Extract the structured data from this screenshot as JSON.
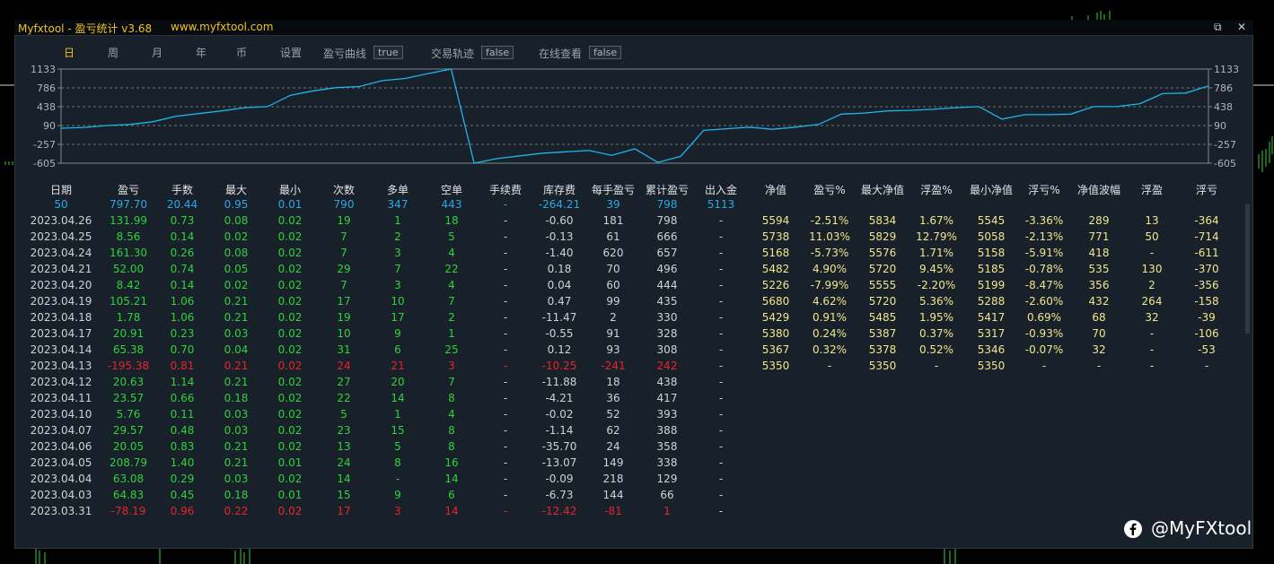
{
  "window": {
    "title": "Myfxtool - 盈亏统计 v3.68",
    "url": "www.myfxtool.com",
    "restore_glyph": "⧉",
    "close_glyph": "✕"
  },
  "tabs": [
    "日",
    "周",
    "月",
    "年",
    "币",
    "设置"
  ],
  "active_tab": "日",
  "toggles": [
    {
      "label": "盈亏曲线",
      "value": "true"
    },
    {
      "label": "交易轨迹",
      "value": "false"
    },
    {
      "label": "在线查看",
      "value": "false"
    }
  ],
  "chart_data": {
    "type": "line",
    "y_ticks": [
      "1133",
      "786",
      "438",
      "90",
      "-257",
      "-605"
    ],
    "ylim": [
      -605,
      1133
    ],
    "grid": "dashed horizontal",
    "line_color": "#1eb4ef",
    "values": [
      40,
      55,
      90,
      110,
      160,
      260,
      310,
      360,
      420,
      440,
      650,
      730,
      790,
      810,
      920,
      960,
      1050,
      1133,
      -605,
      -520,
      -470,
      -420,
      -395,
      -370,
      -460,
      -340,
      -590,
      -480,
      0,
      30,
      60,
      20,
      60,
      110,
      300,
      320,
      360,
      370,
      390,
      420,
      440,
      210,
      290,
      290,
      300,
      440,
      440,
      490,
      680,
      690,
      820
    ]
  },
  "table": {
    "left_headers": [
      "日期",
      "盈亏",
      "手数",
      "最大",
      "最小",
      "次数",
      "多单",
      "空单",
      "手续费",
      "库存费",
      "每手盈亏",
      "累计盈亏",
      "出入金"
    ],
    "right_headers": [
      "净值",
      "盈亏%",
      "最大净值",
      "浮盈%",
      "最小净值",
      "浮亏%",
      "净值波幅",
      "浮盈",
      "浮亏"
    ],
    "summary": [
      "50",
      "797.70",
      "20.44",
      "0.95",
      "0.01",
      "790",
      "347",
      "443",
      "-",
      "-264.21",
      "39",
      "798",
      "5113"
    ],
    "rows": [
      {
        "date": "2023.04.26",
        "pl": "131.99",
        "lots": "0.73",
        "max": "0.08",
        "min": "0.02",
        "count": "19",
        "long": "1",
        "short": "18",
        "fee": "-",
        "swap": "-0.60",
        "plpl": "181",
        "cum": "798",
        "io": "-",
        "loss": false
      },
      {
        "date": "2023.04.25",
        "pl": "8.56",
        "lots": "0.14",
        "max": "0.02",
        "min": "0.02",
        "count": "7",
        "long": "2",
        "short": "5",
        "fee": "-",
        "swap": "-0.13",
        "plpl": "61",
        "cum": "666",
        "io": "-",
        "loss": false
      },
      {
        "date": "2023.04.24",
        "pl": "161.30",
        "lots": "0.26",
        "max": "0.08",
        "min": "0.02",
        "count": "7",
        "long": "3",
        "short": "4",
        "fee": "-",
        "swap": "-1.40",
        "plpl": "620",
        "cum": "657",
        "io": "-",
        "loss": false
      },
      {
        "date": "2023.04.21",
        "pl": "52.00",
        "lots": "0.74",
        "max": "0.05",
        "min": "0.02",
        "count": "29",
        "long": "7",
        "short": "22",
        "fee": "-",
        "swap": "0.18",
        "plpl": "70",
        "cum": "496",
        "io": "-",
        "loss": false
      },
      {
        "date": "2023.04.20",
        "pl": "8.42",
        "lots": "0.14",
        "max": "0.02",
        "min": "0.02",
        "count": "7",
        "long": "3",
        "short": "4",
        "fee": "-",
        "swap": "0.04",
        "plpl": "60",
        "cum": "444",
        "io": "-",
        "loss": false
      },
      {
        "date": "2023.04.19",
        "pl": "105.21",
        "lots": "1.06",
        "max": "0.21",
        "min": "0.02",
        "count": "17",
        "long": "10",
        "short": "7",
        "fee": "-",
        "swap": "0.47",
        "plpl": "99",
        "cum": "435",
        "io": "-",
        "loss": false
      },
      {
        "date": "2023.04.18",
        "pl": "1.78",
        "lots": "1.06",
        "max": "0.21",
        "min": "0.02",
        "count": "19",
        "long": "17",
        "short": "2",
        "fee": "-",
        "swap": "-11.47",
        "plpl": "2",
        "cum": "330",
        "io": "-",
        "loss": false
      },
      {
        "date": "2023.04.17",
        "pl": "20.91",
        "lots": "0.23",
        "max": "0.03",
        "min": "0.02",
        "count": "10",
        "long": "9",
        "short": "1",
        "fee": "-",
        "swap": "-0.55",
        "plpl": "91",
        "cum": "328",
        "io": "-",
        "loss": false
      },
      {
        "date": "2023.04.14",
        "pl": "65.38",
        "lots": "0.70",
        "max": "0.04",
        "min": "0.02",
        "count": "31",
        "long": "6",
        "short": "25",
        "fee": "-",
        "swap": "0.12",
        "plpl": "93",
        "cum": "308",
        "io": "-",
        "loss": false
      },
      {
        "date": "2023.04.13",
        "pl": "-195.38",
        "lots": "0.81",
        "max": "0.21",
        "min": "0.02",
        "count": "24",
        "long": "21",
        "short": "3",
        "fee": "-",
        "swap": "-10.25",
        "plpl": "-241",
        "cum": "242",
        "io": "-",
        "loss": true
      },
      {
        "date": "2023.04.12",
        "pl": "20.63",
        "lots": "1.14",
        "max": "0.21",
        "min": "0.02",
        "count": "27",
        "long": "20",
        "short": "7",
        "fee": "-",
        "swap": "-11.88",
        "plpl": "18",
        "cum": "438",
        "io": "-",
        "loss": false
      },
      {
        "date": "2023.04.11",
        "pl": "23.57",
        "lots": "0.66",
        "max": "0.18",
        "min": "0.02",
        "count": "22",
        "long": "14",
        "short": "8",
        "fee": "-",
        "swap": "-4.21",
        "plpl": "36",
        "cum": "417",
        "io": "-",
        "loss": false
      },
      {
        "date": "2023.04.10",
        "pl": "5.76",
        "lots": "0.11",
        "max": "0.03",
        "min": "0.02",
        "count": "5",
        "long": "1",
        "short": "4",
        "fee": "-",
        "swap": "-0.02",
        "plpl": "52",
        "cum": "393",
        "io": "-",
        "loss": false
      },
      {
        "date": "2023.04.07",
        "pl": "29.57",
        "lots": "0.48",
        "max": "0.03",
        "min": "0.02",
        "count": "23",
        "long": "15",
        "short": "8",
        "fee": "-",
        "swap": "-1.14",
        "plpl": "62",
        "cum": "388",
        "io": "-",
        "loss": false
      },
      {
        "date": "2023.04.06",
        "pl": "20.05",
        "lots": "0.83",
        "max": "0.21",
        "min": "0.02",
        "count": "13",
        "long": "5",
        "short": "8",
        "fee": "-",
        "swap": "-35.70",
        "plpl": "24",
        "cum": "358",
        "io": "-",
        "loss": false
      },
      {
        "date": "2023.04.05",
        "pl": "208.79",
        "lots": "1.40",
        "max": "0.21",
        "min": "0.01",
        "count": "24",
        "long": "8",
        "short": "16",
        "fee": "-",
        "swap": "-13.07",
        "plpl": "149",
        "cum": "338",
        "io": "-",
        "loss": false
      },
      {
        "date": "2023.04.04",
        "pl": "63.08",
        "lots": "0.29",
        "max": "0.03",
        "min": "0.02",
        "count": "14",
        "long": "-",
        "short": "14",
        "fee": "-",
        "swap": "-0.09",
        "plpl": "218",
        "cum": "129",
        "io": "-",
        "loss": false
      },
      {
        "date": "2023.04.03",
        "pl": "64.83",
        "lots": "0.45",
        "max": "0.18",
        "min": "0.01",
        "count": "15",
        "long": "9",
        "short": "6",
        "fee": "-",
        "swap": "-6.73",
        "plpl": "144",
        "cum": "66",
        "io": "-",
        "loss": false
      },
      {
        "date": "2023.03.31",
        "pl": "-78.19",
        "lots": "0.96",
        "max": "0.22",
        "min": "0.02",
        "count": "17",
        "long": "3",
        "short": "14",
        "fee": "-",
        "swap": "-12.42",
        "plpl": "-81",
        "cum": "1",
        "io": "-",
        "loss": true
      }
    ],
    "right_rows": [
      [
        "5594",
        "-2.51%",
        "5834",
        "1.67%",
        "5545",
        "-3.36%",
        "289",
        "13",
        "-364"
      ],
      [
        "5738",
        "11.03%",
        "5829",
        "12.79%",
        "5058",
        "-2.13%",
        "771",
        "50",
        "-714"
      ],
      [
        "5168",
        "-5.73%",
        "5576",
        "1.71%",
        "5158",
        "-5.91%",
        "418",
        "-",
        "-611"
      ],
      [
        "5482",
        "4.90%",
        "5720",
        "9.45%",
        "5185",
        "-0.78%",
        "535",
        "130",
        "-370"
      ],
      [
        "5226",
        "-7.99%",
        "5555",
        "-2.20%",
        "5199",
        "-8.47%",
        "356",
        "2",
        "-356"
      ],
      [
        "5680",
        "4.62%",
        "5720",
        "5.36%",
        "5288",
        "-2.60%",
        "432",
        "264",
        "-158"
      ],
      [
        "5429",
        "0.91%",
        "5485",
        "1.95%",
        "5417",
        "0.69%",
        "68",
        "32",
        "-39"
      ],
      [
        "5380",
        "0.24%",
        "5387",
        "0.37%",
        "5317",
        "-0.93%",
        "70",
        "-",
        "-106"
      ],
      [
        "5367",
        "0.32%",
        "5378",
        "0.52%",
        "5346",
        "-0.07%",
        "32",
        "-",
        "-53"
      ],
      [
        "5350",
        "-",
        "5350",
        "-",
        "5350",
        "-",
        "-",
        "-",
        "-"
      ]
    ]
  },
  "watermark": "@MyFXtool",
  "colors": {
    "profit": "#2fd23c",
    "loss": "#e6262a",
    "summary": "#28a8ea",
    "right_table": "#f0e68c",
    "title": "#f2c21b"
  }
}
